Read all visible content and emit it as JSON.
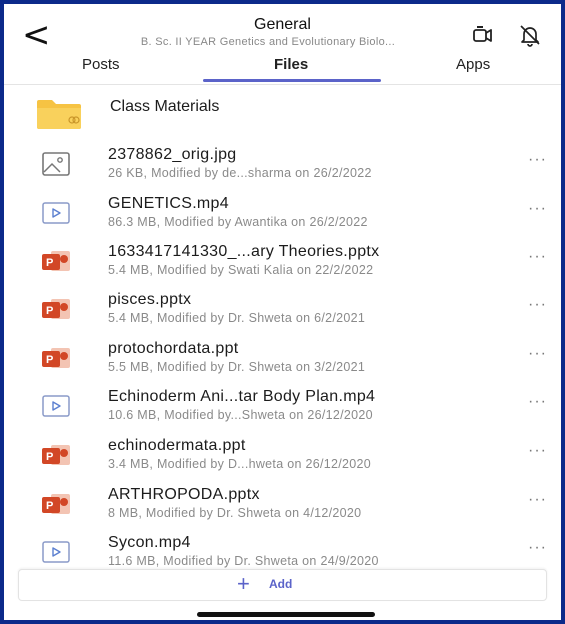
{
  "header": {
    "back": "<",
    "title": "General",
    "subtitle": "B. Sc. II YEAR Genetics and Evolutionary Biolo...",
    "icons": [
      "meet-now-icon",
      "notifications-off-icon"
    ]
  },
  "tabs": [
    {
      "label": "Posts"
    },
    {
      "label": "Files",
      "active": true
    },
    {
      "label": "Apps"
    }
  ],
  "folder": {
    "name": "Class Materials"
  },
  "files": [
    {
      "type": "image",
      "name": "2378862_orig.jpg",
      "meta": "26 KB, Modified by de...sharma on 26/2/2022"
    },
    {
      "type": "video",
      "name": "GENETICS.mp4",
      "meta": "86.3 MB, Modified by Awantika on 26/2/2022"
    },
    {
      "type": "ppt",
      "name": "1633417141330_...ary Theories.pptx",
      "meta": "5.4 MB, Modified by Swati Kalia on 22/2/2022"
    },
    {
      "type": "ppt",
      "name": "pisces.pptx",
      "meta": "5.4 MB, Modified by Dr. Shweta on 6/2/2021"
    },
    {
      "type": "ppt",
      "name": "protochordata.ppt",
      "meta": "5.5 MB, Modified by Dr. Shweta on 3/2/2021"
    },
    {
      "type": "video",
      "name": "Echinoderm Ani...tar Body Plan.mp4",
      "meta": "10.6 MB, Modified by...Shweta on 26/12/2020"
    },
    {
      "type": "ppt",
      "name": "echinodermata.ppt",
      "meta": "3.4 MB, Modified by D...hweta on 26/12/2020"
    },
    {
      "type": "ppt",
      "name": "ARTHROPODA.pptx",
      "meta": "8 MB, Modified by Dr. Shweta on 4/12/2020"
    },
    {
      "type": "video",
      "name": "Sycon.mp4",
      "meta": "11.6 MB, Modified by Dr. Shweta on 24/9/2020"
    }
  ],
  "more_label": "···",
  "add": {
    "plus": "+",
    "label": "Add"
  },
  "colors": {
    "accent": "#5b63c9",
    "ppt": "#d24726",
    "folder": "#f6c343",
    "frame_border": "#0c2a8a"
  }
}
